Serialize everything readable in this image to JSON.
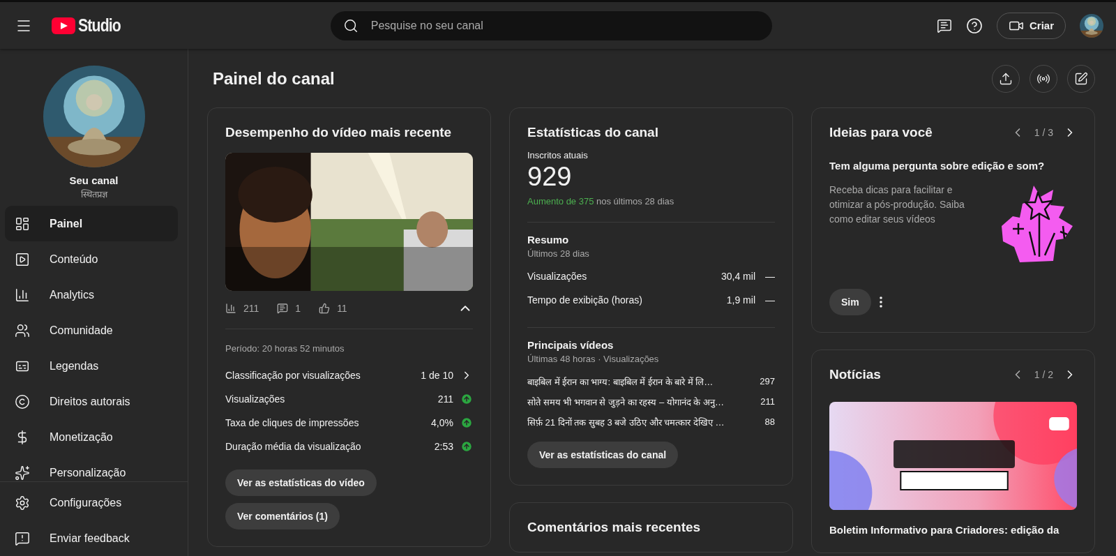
{
  "header": {
    "search_placeholder": "Pesquise no seu canal",
    "create_label": "Criar",
    "logo_text": "Studio"
  },
  "sidebar": {
    "channel_name": "Seu canal",
    "channel_handle": "स्थितप्रज्ञ",
    "nav": [
      {
        "label": "Painel",
        "selected": true
      },
      {
        "label": "Conteúdo",
        "selected": false
      },
      {
        "label": "Analytics",
        "selected": false
      },
      {
        "label": "Comunidade",
        "selected": false
      },
      {
        "label": "Legendas",
        "selected": false
      },
      {
        "label": "Direitos autorais",
        "selected": false
      },
      {
        "label": "Monetização",
        "selected": false
      },
      {
        "label": "Personalização",
        "selected": false
      }
    ],
    "footer_nav": [
      {
        "label": "Configurações"
      },
      {
        "label": "Enviar feedback"
      }
    ]
  },
  "page_title": "Painel do canal",
  "video_card": {
    "title": "Desempenho do vídeo mais recente",
    "views": "211",
    "comments": "1",
    "likes": "11",
    "expanded": true,
    "period": "Período: 20 horas 52 minutos",
    "metrics": [
      {
        "kind": "link",
        "label": "Classificação por visualizações",
        "value": "1 de 10"
      },
      {
        "kind": "trend_up",
        "label": "Visualizações",
        "value": "211"
      },
      {
        "kind": "trend_up",
        "label": "Taxa de cliques de impressões",
        "value": "4,0%"
      },
      {
        "kind": "trend_up",
        "label": "Duração média da visualização",
        "value": "2:53"
      }
    ],
    "buttons": [
      "Ver as estatísticas do vídeo",
      "Ver comentários (1)"
    ]
  },
  "channel_stats": {
    "title": "Estatísticas do canal",
    "subscribers_label": "Inscritos atuais",
    "subscribers": "929",
    "growth": "Aumento de 375",
    "growth_rest": "nos últimos 28 dias",
    "summary_title": "Resumo",
    "summary_period": "Últimos 28 dias",
    "summary_rows": [
      {
        "label": "Visualizações",
        "value": "30,4 mil",
        "change": "—"
      },
      {
        "label": "Tempo de exibição (horas)",
        "value": "1,9 mil",
        "change": "—"
      }
    ],
    "top_title": "Principais vídeos",
    "top_period": "Últimas 48 horas · Visualizações",
    "top_videos": [
      {
        "title": "बाइबिल में ईरान का भाग्य: बाइबिल में ईरान के बारे में लि…",
        "views": "297"
      },
      {
        "title": "सोते समय भी भगवान से जुड़ने का रहस्य – योगानंद के अनु…",
        "views": "211"
      },
      {
        "title": "सिर्फ़ 21 दिनों तक सुबह 3 बजे उठिए और चमत्कार देखिए …",
        "views": "88"
      }
    ],
    "button": "Ver as estatísticas do canal"
  },
  "comments_card": {
    "title": "Comentários mais recentes"
  },
  "ideas": {
    "title": "Ideias para você",
    "pager": "1 / 3",
    "question": "Tem alguma pergunta sobre edição e som?",
    "body": "Receba dicas para facilitar e otimizar a pós-produção. Saiba como editar seus vídeos",
    "button": "Sim"
  },
  "news": {
    "title": "Notícias",
    "pager": "1 / 2",
    "article_title": "Boletim Informativo para Criadores: edição da"
  }
}
